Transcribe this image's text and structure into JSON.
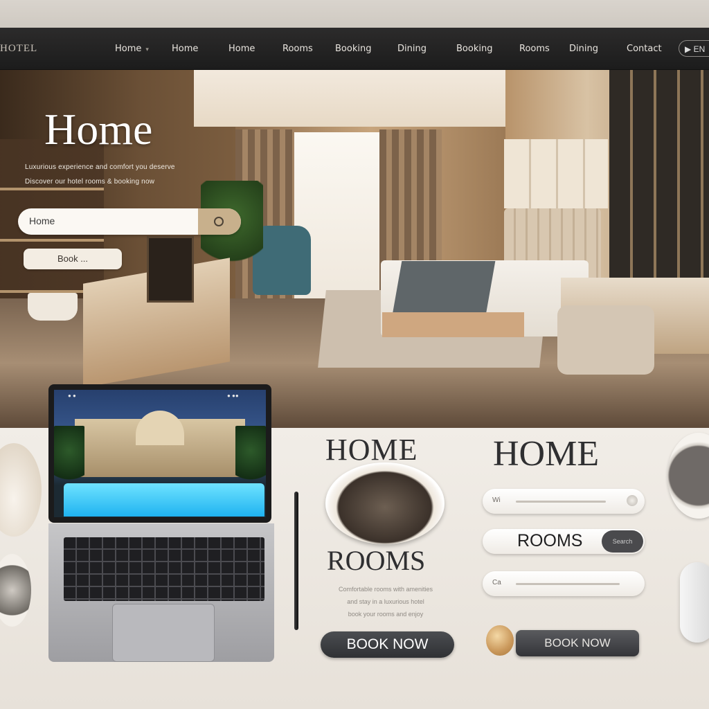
{
  "header": {
    "logo": "HOTEL",
    "nav": [
      {
        "label": "Home"
      },
      {
        "label": "Home"
      },
      {
        "label": "Home"
      },
      {
        "label": "Rooms"
      },
      {
        "label": "Booking"
      },
      {
        "label": "Dining"
      },
      {
        "label": "Booking"
      },
      {
        "label": "Rooms"
      },
      {
        "label": "Dining"
      },
      {
        "label": "Contact"
      }
    ],
    "cta": "▶ EN"
  },
  "hero": {
    "title": "Home",
    "subtitle_line1": "Luxurious experience and comfort you deserve",
    "subtitle_line2": "Discover our hotel rooms & booking now",
    "search_placeholder": "Home",
    "book_label": "Book  ..."
  },
  "laptop": {
    "status_left": "●  ●",
    "status_right": "●  ●●"
  },
  "cards": {
    "home_title_1": "HOME",
    "rooms_title": "ROOMS",
    "rooms_desc_line1": "Comfortable rooms with amenities",
    "rooms_desc_line2": "and stay in a luxurious hotel",
    "rooms_desc_line3": "book your rooms and enjoy",
    "book_now_1": "BOOK NOW",
    "home_title_2": "HOME",
    "pill1_text": "Wi",
    "rooms_pill_label": "ROOMS",
    "rooms_pill_btn": "Search",
    "pill3_text": "Ca",
    "book_now_2": "BOOK NOW"
  },
  "colors": {
    "nav_bg": "#1f1f1f",
    "accent_gold": "#c8b08c",
    "button_dark": "#3a3b3e"
  }
}
